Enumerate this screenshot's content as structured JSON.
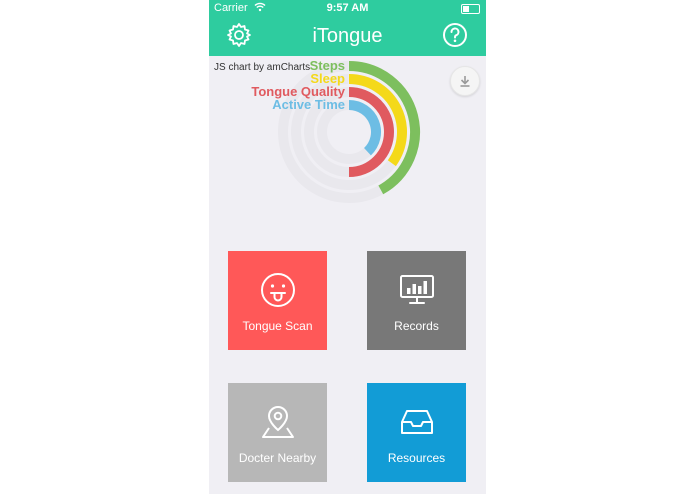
{
  "status_bar": {
    "carrier": "Carrier",
    "time": "9:57 AM"
  },
  "navbar": {
    "title": "iTongue",
    "left_icon": "gear-icon",
    "right_icon": "help-icon"
  },
  "chart": {
    "credit": "JS chart by amCharts",
    "download_icon": "download-icon"
  },
  "chart_data": {
    "type": "radial-bar",
    "series": [
      {
        "name": "Steps",
        "value": 0.42,
        "color": "#7dbf5e"
      },
      {
        "name": "Sleep",
        "value": 0.35,
        "color": "#f4d91a"
      },
      {
        "name": "Tongue Quality",
        "value": 0.5,
        "color": "#e05a5f"
      },
      {
        "name": "Active Time",
        "value": 0.38,
        "color": "#6dbde4"
      }
    ]
  },
  "tiles": [
    {
      "label": "Tongue Scan",
      "icon": "tongue-face-icon",
      "color": "#ff5858"
    },
    {
      "label": "Records",
      "icon": "monitor-chart-icon",
      "color": "#787878"
    },
    {
      "label": "Docter Nearby",
      "icon": "map-pin-icon",
      "color": "#b7b7b7"
    },
    {
      "label": "Resources",
      "icon": "inbox-tray-icon",
      "color": "#129cd6"
    }
  ]
}
